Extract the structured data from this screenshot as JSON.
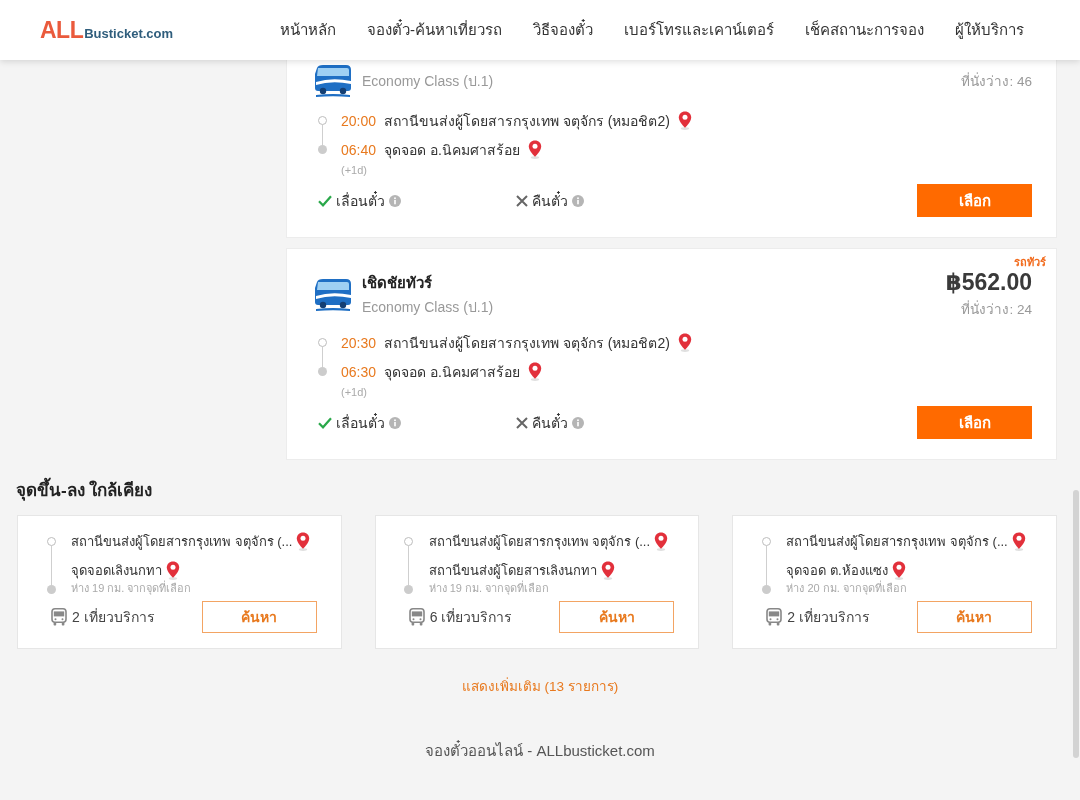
{
  "header": {
    "logo": {
      "brand": "ALL",
      "domain": "Busticket.com"
    },
    "nav": [
      {
        "label": "หน้าหลัก"
      },
      {
        "label": "จองตั๋ว-ค้นหาเที่ยวรถ"
      },
      {
        "label": "วิธีจองตั๋ว"
      },
      {
        "label": "เบอร์โทรและเคาน์เตอร์"
      },
      {
        "label": "เช็คสถานะการจอง"
      },
      {
        "label": "ผู้ให้บริการ"
      }
    ]
  },
  "trips": [
    {
      "bus_class": "Economy Class (ป.1)",
      "seats": "ที่นั่งว่าง: 46",
      "stops": [
        {
          "time": "20:00",
          "place": "สถานีขนส่งผู้โดยสารกรุงเทพ จตุจักร (หมอชิต2)"
        },
        {
          "time": "06:40",
          "place": "จุดจอด อ.นิคมศาสร้อย",
          "day_offset": "(+1d)"
        }
      ],
      "features": [
        {
          "label": "เลื่อนตั๋ว",
          "allowed": true
        },
        {
          "label": "คืนตั๋ว",
          "allowed": false
        }
      ],
      "button": "เลือก"
    },
    {
      "tag": "รถทัวร์",
      "operator": "เชิดชัยทัวร์",
      "bus_class": "Economy Class (ป.1)",
      "price": "฿562.00",
      "seats": "ที่นั่งว่าง: 24",
      "stops": [
        {
          "time": "20:30",
          "place": "สถานีขนส่งผู้โดยสารกรุงเทพ จตุจักร (หมอชิต2)"
        },
        {
          "time": "06:30",
          "place": "จุดจอด อ.นิคมศาสร้อย",
          "day_offset": "(+1d)"
        }
      ],
      "features": [
        {
          "label": "เลื่อนตั๋ว",
          "allowed": true
        },
        {
          "label": "คืนตั๋ว",
          "allowed": false
        }
      ],
      "button": "เลือก"
    }
  ],
  "nearby": {
    "title": "จุดขึ้น-ลง ใกล้เคียง",
    "stations": [
      {
        "from": "สถานีขนส่งผู้โดยสารกรุงเทพ จตุจักร (...",
        "to": "จุดจอดเลิงนกทา",
        "distance": "ห่าง 19 กม. จากจุดที่เลือก",
        "trip_count": "2 เที่ยวบริการ",
        "button": "ค้นหา"
      },
      {
        "from": "สถานีขนส่งผู้โดยสารกรุงเทพ จตุจักร (...",
        "to": "สถานีขนส่งผู้โดยสารเลิงนกทา",
        "distance": "ห่าง 19 กม. จากจุดที่เลือก",
        "trip_count": "6 เที่ยวบริการ",
        "button": "ค้นหา"
      },
      {
        "from": "สถานีขนส่งผู้โดยสารกรุงเทพ จตุจักร (...",
        "to": "จุดจอด ต.ห้องแซง",
        "distance": "ห่าง 20 กม. จากจุดที่เลือก",
        "trip_count": "2 เที่ยวบริการ",
        "button": "ค้นหา"
      }
    ]
  },
  "more_link": "แสดงเพิ่มเติม (13 รายการ)",
  "footer": {
    "text": "จองตั๋วออนไลน์ - ALLbusticket.com"
  }
}
